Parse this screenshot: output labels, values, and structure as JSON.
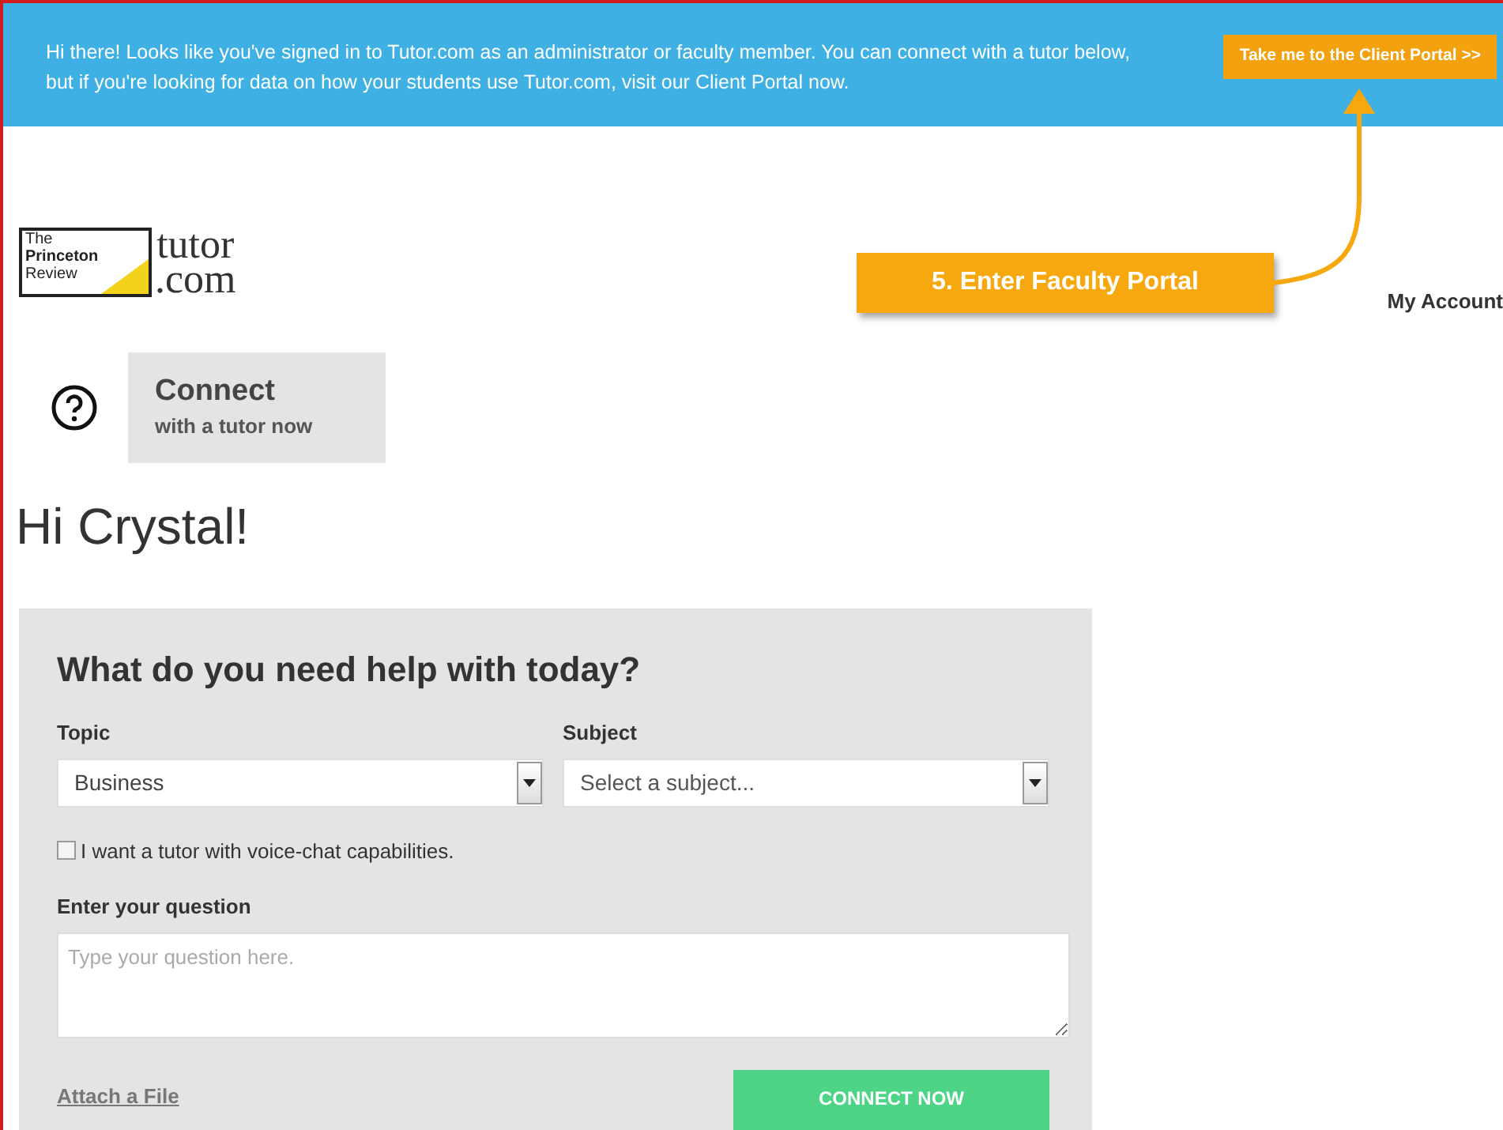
{
  "banner": {
    "message": "Hi there! Looks like you've signed in to Tutor.com as an administrator or faculty member. You can connect with a tutor below, but if you're looking for data on how your students use Tutor.com, visit our Client Portal now.",
    "button": "Take me to the Client Portal >>"
  },
  "logo": {
    "review_lines": [
      "The",
      "Princeton",
      "Review"
    ],
    "tutor_lines": [
      "tutor",
      ".com"
    ]
  },
  "annotation": {
    "label": "5. Enter Faculty Portal"
  },
  "nav": {
    "account": "My Account"
  },
  "connect": {
    "title": "Connect",
    "subtitle": "with a tutor now"
  },
  "greeting": "Hi Crystal!",
  "form": {
    "heading": "What do you need help with today?",
    "selects": [
      {
        "label": "Topic",
        "value": "Business"
      },
      {
        "label": "Subject",
        "placeholder": "Select a subject..."
      }
    ],
    "voice_chat": {
      "label": "I want a tutor with voice-chat capabilities.",
      "checked": false
    },
    "question": {
      "label": "Enter your question",
      "placeholder": "Type your question here."
    },
    "attach": "Attach a File",
    "submit": "CONNECT NOW"
  }
}
